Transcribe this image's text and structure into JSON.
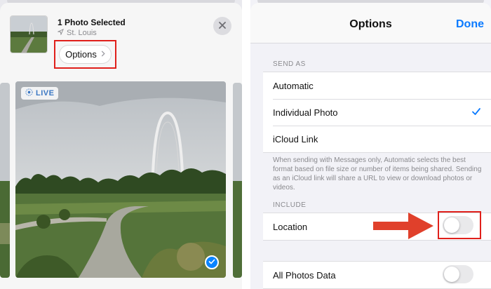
{
  "left_panel": {
    "header": {
      "title": "1 Photo Selected",
      "location": "St. Louis",
      "options_label": "Options"
    },
    "photo": {
      "live_label": "LIVE",
      "selected": true
    },
    "icons": [
      "location-arrow-icon",
      "close-icon",
      "chevron-right-icon",
      "live-photo-icon",
      "checkmark-icon"
    ]
  },
  "right_panel": {
    "nav": {
      "title": "Options",
      "done_label": "Done"
    },
    "send_as": {
      "header": "SEND AS",
      "items": [
        {
          "label": "Automatic",
          "checked": false
        },
        {
          "label": "Individual Photo",
          "checked": true
        },
        {
          "label": "iCloud Link",
          "checked": false
        }
      ],
      "footnote": "When sending with Messages only, Automatic selects the best format based on file size or number of items being shared. Sending as an iCloud link will share a URL to view or download photos or videos."
    },
    "include": {
      "header": "INCLUDE",
      "items": [
        {
          "label": "Location",
          "on": false
        },
        {
          "label": "All Photos Data",
          "on": false
        }
      ]
    }
  },
  "colors": {
    "accent": "#0a7aff",
    "highlight_box": "#e0201b",
    "toggle_off": "#e9e9eb"
  }
}
